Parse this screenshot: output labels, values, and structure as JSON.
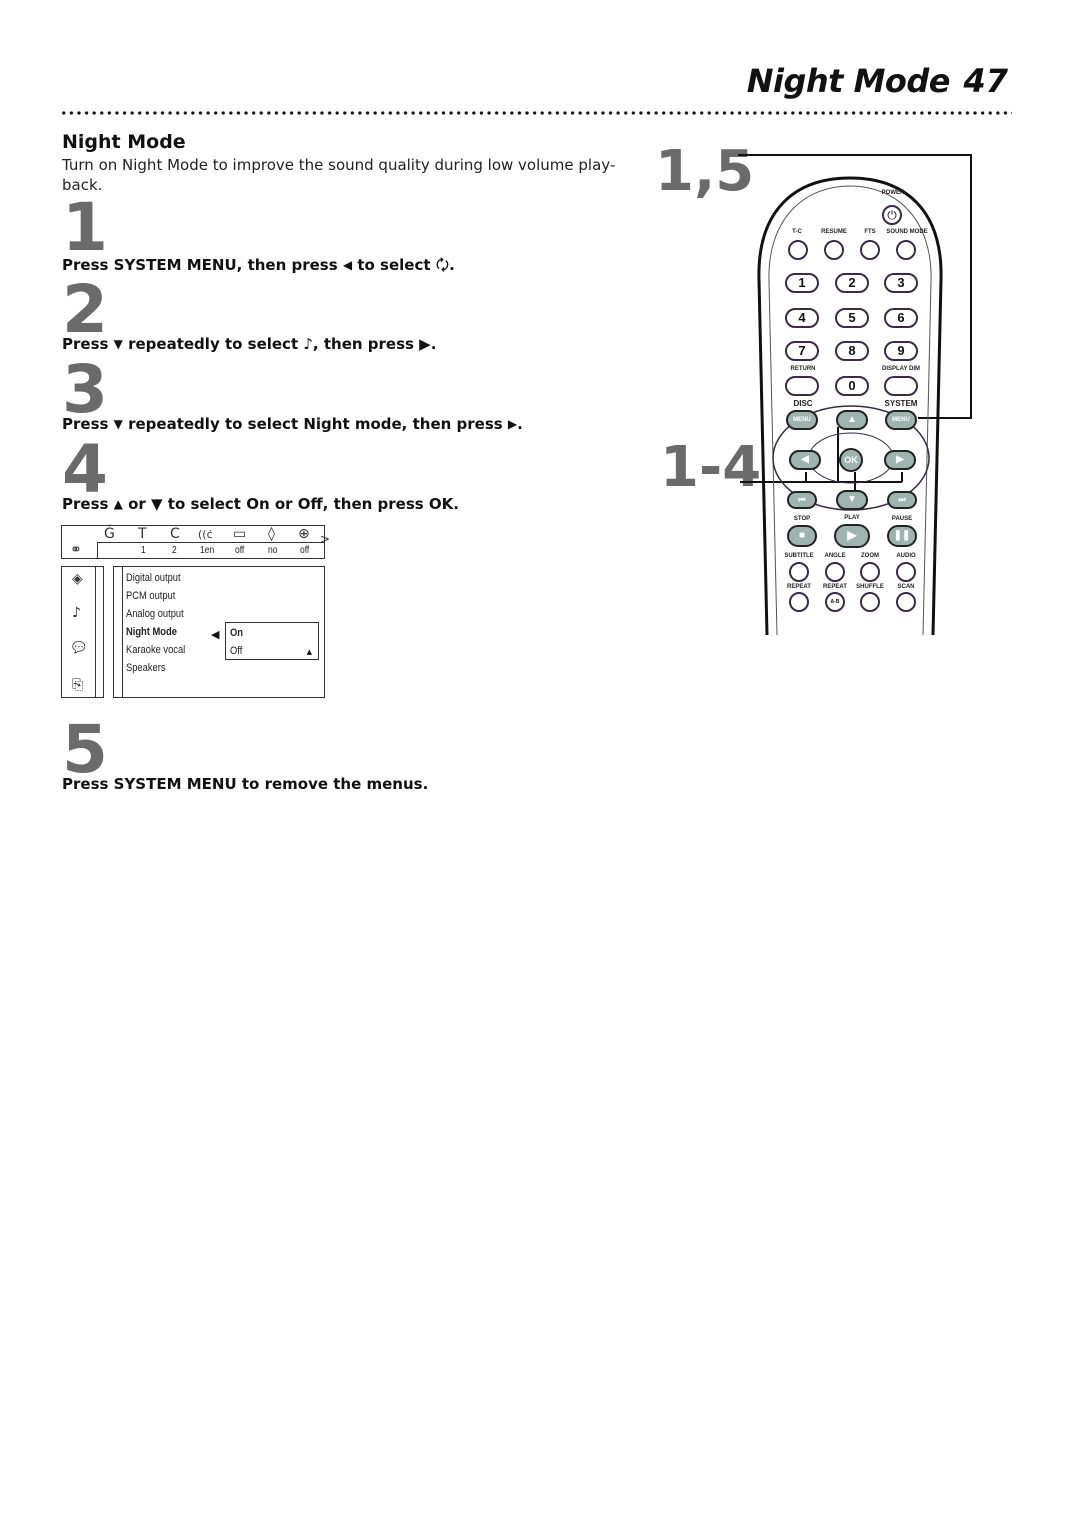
{
  "header": {
    "title": "Night Mode",
    "page_number": "47"
  },
  "section": {
    "heading": "Night Mode",
    "intro": "Turn on Night Mode to improve the sound quality during low volume play-back."
  },
  "steps": [
    {
      "number": "1",
      "text_before": "Press SYSTEM MENU, then press ",
      "arrow": "◀",
      "text_after": " to select ",
      "symbol": "🗘",
      "text_end": "."
    },
    {
      "number": "2",
      "text_before": "Press ",
      "arrow": "▼",
      "text_after": " repeatedly to select ",
      "symbol": "♪",
      "text_end": ", then press ▶."
    },
    {
      "number": "3",
      "text_before": "Press ",
      "arrow": "▼",
      "text_after": " repeatedly to select Night mode, then press ",
      "symbol": "▶",
      "text_end": "."
    },
    {
      "number": "4",
      "text_before": "Press ",
      "arrow": "▲",
      "text_after": " or ▼ to select On or Off, then press OK.",
      "symbol": "",
      "text_end": ""
    },
    {
      "number": "5",
      "text_before": "Press SYSTEM MENU to remove the menus.",
      "arrow": "",
      "text_after": "",
      "symbol": "",
      "text_end": ""
    }
  ],
  "osd": {
    "top_icons": [
      "title-icon",
      "t-icon",
      "chapter-icon",
      "audio-icon",
      "subtitle-icon",
      "angle-icon",
      "zoom-icon"
    ],
    "top_icon_glyphs": [
      "Ǵ",
      "T",
      "C",
      "((ċ",
      "▭",
      "◊",
      "⊕"
    ],
    "top_values": [
      "1",
      "2",
      "1en",
      "off",
      "no",
      "off"
    ],
    "disc_glyph": "⚭",
    "more_glyph": ">",
    "side_icons": [
      "◈",
      "♪",
      "💬",
      "⎘"
    ],
    "menu_items": [
      "Digital output",
      "PCM output",
      "Analog output",
      "Night Mode",
      "Karaoke vocal",
      "Speakers"
    ],
    "selected_item": "Night Mode",
    "selector_arrow": "◀",
    "options": [
      "On",
      "Off"
    ],
    "selected_option": "On",
    "scroll_glyph": "▲"
  },
  "callouts": {
    "top": "1,5",
    "middle": "1-4"
  },
  "remote": {
    "power_label": "POWER",
    "row1_labels": [
      "T-C",
      "RESUME",
      "FTS",
      "SOUND MODE"
    ],
    "numbers": [
      "1",
      "2",
      "3",
      "4",
      "5",
      "6",
      "7",
      "8",
      "9",
      "0"
    ],
    "return_label": "RETURN",
    "display_dim_label": "DISPLAY DIM",
    "disc_label": "DISC",
    "system_label": "SYSTEM",
    "menu_label": "MENU",
    "ok_label": "OK",
    "transport_labels": [
      "STOP",
      "PLAY",
      "PAUSE"
    ],
    "row_sub_labels": [
      "SUBTITLE",
      "ANGLE",
      "ZOOM",
      "AUDIO"
    ],
    "row_rep_labels": [
      "REPEAT",
      "REPEAT",
      "SHUFFLE",
      "SCAN"
    ],
    "ab_label": "A-B"
  }
}
